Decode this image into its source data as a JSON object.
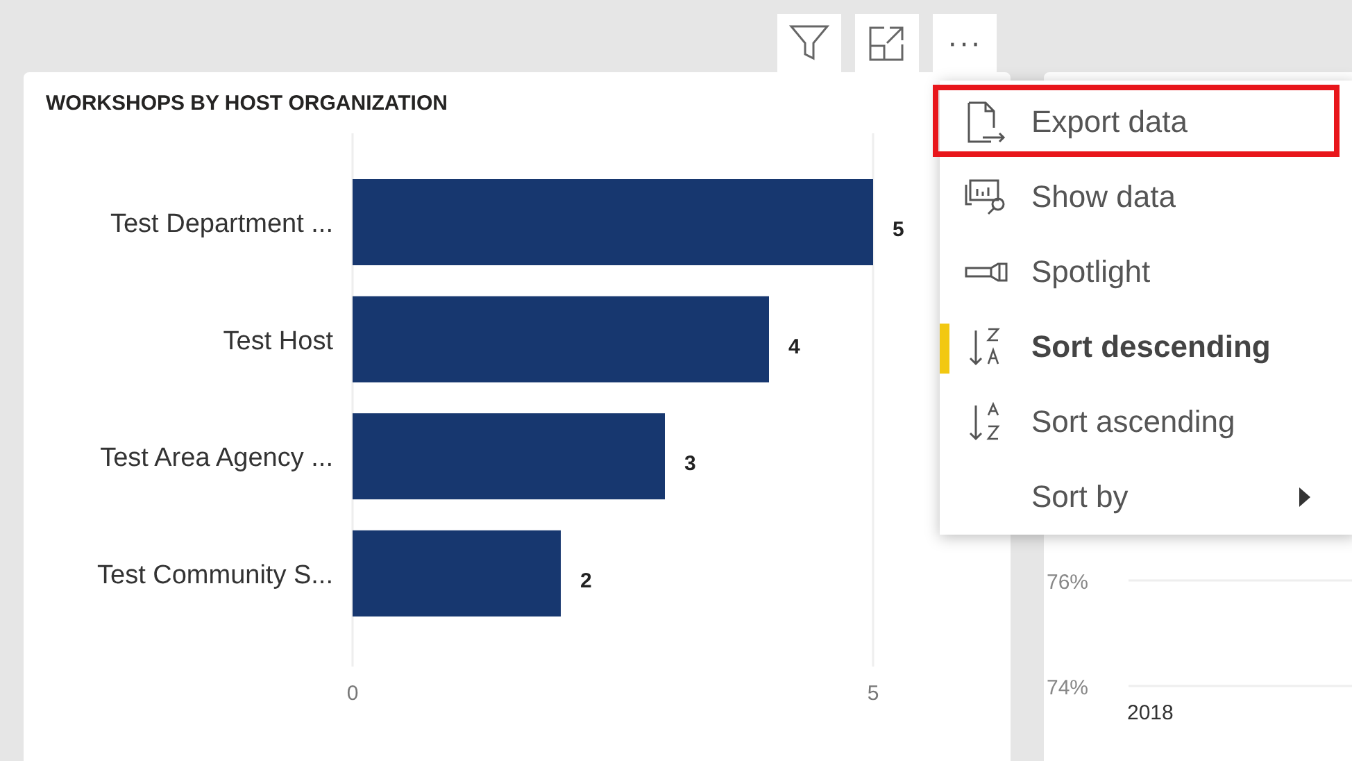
{
  "toolbar": {
    "buttons": [
      {
        "kind": "filter"
      },
      {
        "kind": "focus"
      },
      {
        "kind": "more",
        "label": "···"
      }
    ]
  },
  "visual": {
    "title": "WORKSHOPS BY HOST ORGANIZATION",
    "chart_data": {
      "type": "bar",
      "orientation": "horizontal",
      "categories": [
        "Test Department ...",
        "Test Host",
        "Test Area Agency ...",
        "Test Community S..."
      ],
      "values": [
        5,
        4,
        3,
        2
      ],
      "xlim": [
        0,
        5
      ],
      "xticks": [
        0,
        5
      ],
      "data_labels": true
    }
  },
  "context_menu": {
    "items": [
      {
        "kind": "export",
        "label": "Export data",
        "highlighted": true,
        "selected": false
      },
      {
        "kind": "show",
        "label": "Show data",
        "highlighted": false,
        "selected": false
      },
      {
        "kind": "spotlight",
        "label": "Spotlight",
        "highlighted": false,
        "selected": false
      },
      {
        "kind": "sort-desc",
        "label": "Sort descending",
        "highlighted": false,
        "selected": true
      },
      {
        "kind": "sort-asc",
        "label": "Sort ascending",
        "highlighted": false,
        "selected": false
      },
      {
        "kind": "submenu",
        "label": "Sort by",
        "highlighted": false,
        "selected": false
      }
    ]
  },
  "side_visual": {
    "ytick_labels": [
      "76%",
      "74%"
    ],
    "xtick_labels": [
      "2018"
    ]
  }
}
